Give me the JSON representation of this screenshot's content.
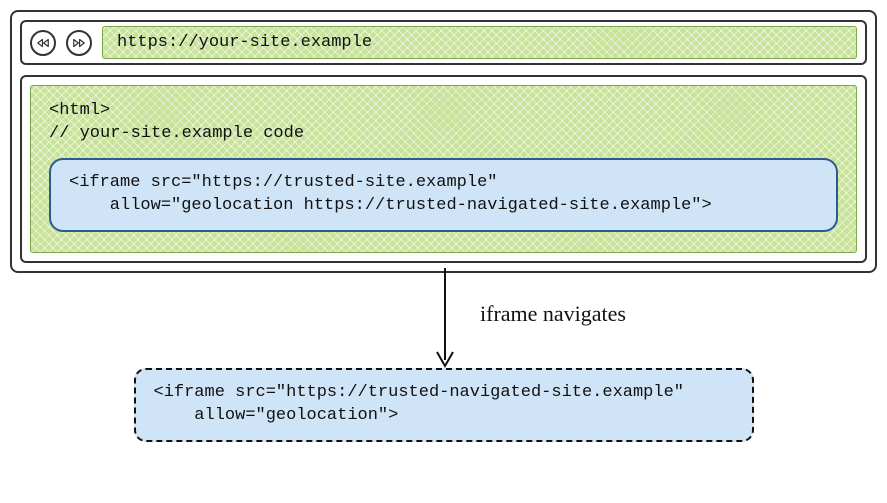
{
  "browser": {
    "url": "https://your-site.example",
    "code_header": "<html>\n// your-site.example code",
    "iframe_initial": "<iframe src=\"https://trusted-site.example\"\n    allow=\"geolocation https://trusted-navigated-site.example\">"
  },
  "arrow_label": "iframe navigates",
  "iframe_result": "<iframe src=\"https://trusted-navigated-site.example\"\n    allow=\"geolocation\">"
}
